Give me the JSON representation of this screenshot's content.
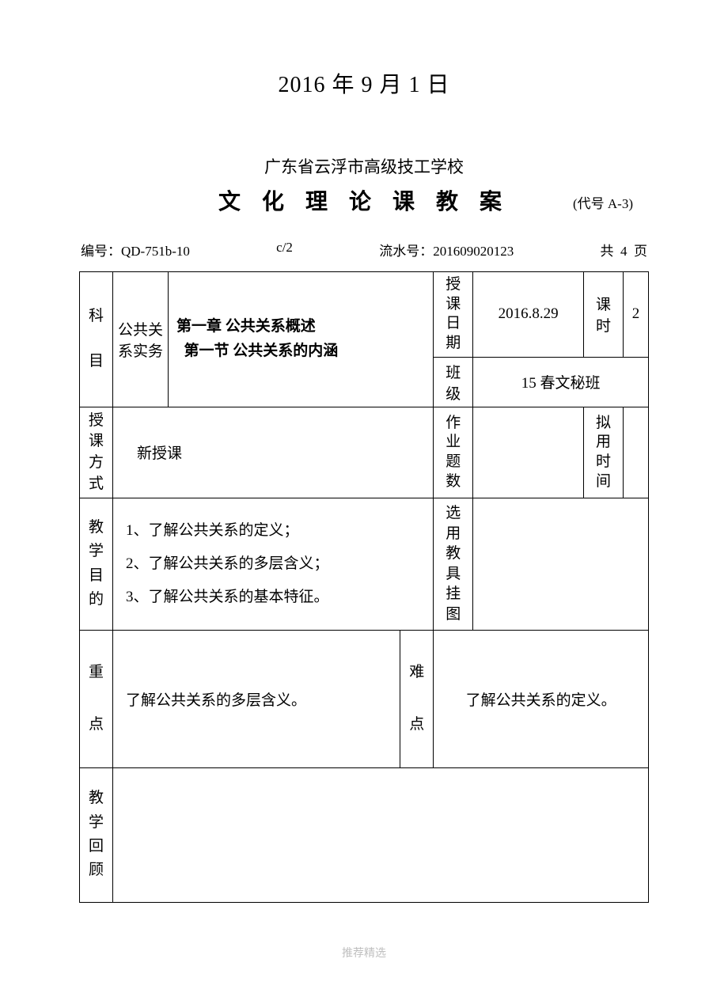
{
  "header": {
    "date_title": "2016 年 9 月 1 日",
    "school": "广东省云浮市高级技工学校",
    "doc_title": "文 化 理 论 课 教 案",
    "doc_code": "(代号 A-3)"
  },
  "meta": {
    "bianhao_label": "编号：",
    "bianhao_value": "QD-751b-10",
    "version": "c/2",
    "serial_label": "流水号：",
    "serial_value": "201609020123",
    "pages_label_pre": "共",
    "pages_value": "4",
    "pages_label_post": "页"
  },
  "row1": {
    "subject_label_1": "科",
    "subject_label_2": "目",
    "subject_value": "公共关系实务",
    "chapter_line1": "第一章 公共关系概述",
    "chapter_line2": "  第一节 公共关系的内涵",
    "date_label": "授课日期",
    "date_value": "2016.8.29",
    "hours_label": "课时",
    "hours_value": "2",
    "class_label": "班级",
    "class_value": "15 春文秘班"
  },
  "row2": {
    "method_label": "授课方式",
    "method_value": "新授课",
    "homework_label": "作业题数",
    "homework_value": "",
    "time_label": "拟用时间",
    "time_value": ""
  },
  "row3": {
    "goal_label": "教学目的",
    "goal_1": "1、了解公共关系的定义；",
    "goal_2": "2、了解公共关系的多层含义；",
    "goal_3": "3、了解公共关系的基本特征。",
    "aids_label": "选用教具挂图",
    "aids_value": ""
  },
  "row4": {
    "key_label_1": "重",
    "key_label_2": "点",
    "key_value": "了解公共关系的多层含义。",
    "diff_label_1": "难",
    "diff_label_2": "点",
    "diff_value": "了解公共关系的定义。"
  },
  "row5": {
    "review_label": "教学回顾",
    "review_value": ""
  },
  "footer": "推荐精选"
}
